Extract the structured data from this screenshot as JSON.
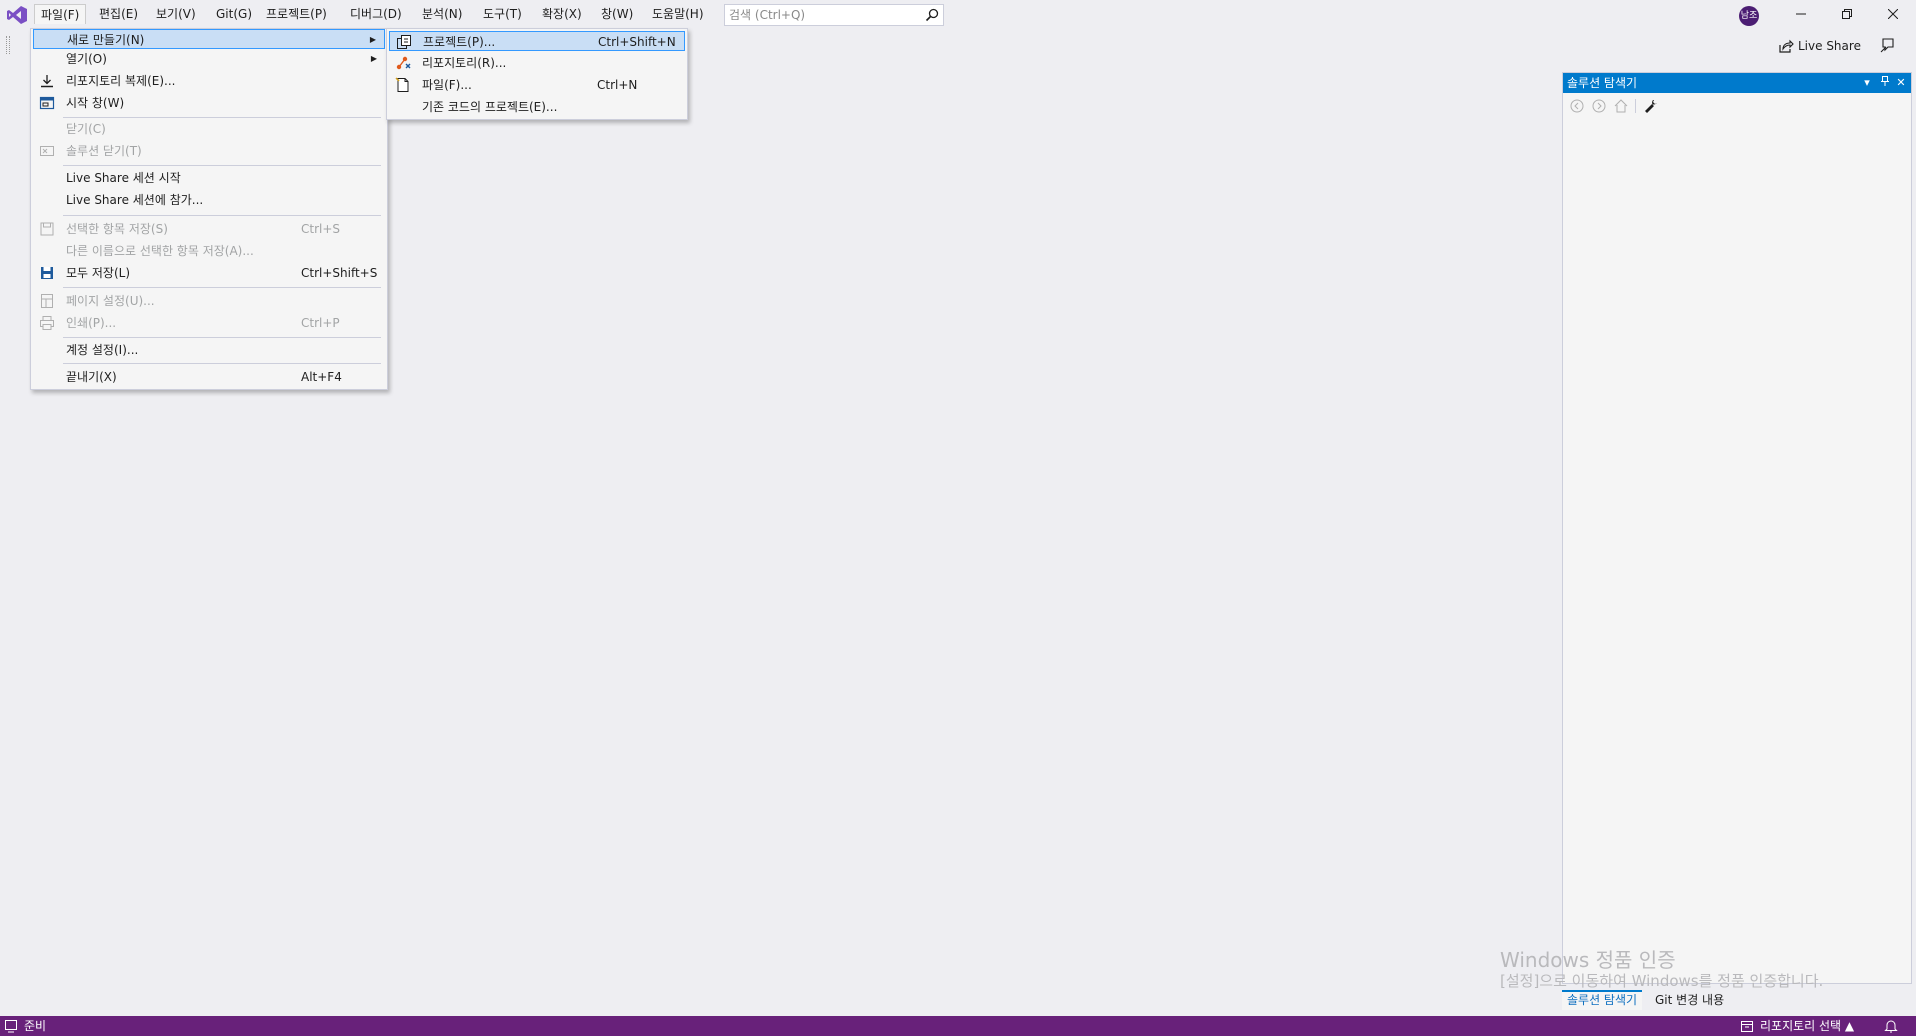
{
  "menubar": {
    "items": [
      "파일(F)",
      "편집(E)",
      "보기(V)",
      "Git(G)",
      "프로젝트(P)",
      "디버그(D)",
      "분석(N)",
      "도구(T)",
      "확장(X)",
      "창(W)",
      "도움말(H)"
    ]
  },
  "search": {
    "placeholder": "검색 (Ctrl+Q)"
  },
  "user": {
    "avatar_text": "남조"
  },
  "toolbar": {
    "live_share": "Live Share"
  },
  "file_menu": {
    "new": "새로 만들기(N)",
    "open": "열기(O)",
    "clone": "리포지토리 복제(E)...",
    "start_window": "시작 창(W)",
    "close": "닫기(C)",
    "close_solution": "솔루션 닫기(T)",
    "ls_start": "Live Share 세션 시작",
    "ls_join": "Live Share 세션에 참가...",
    "save_selected": "선택한 항목 저장(S)",
    "save_selected_sc": "Ctrl+S",
    "save_as": "다른 이름으로 선택한 항목 저장(A)...",
    "save_all": "모두 저장(L)",
    "save_all_sc": "Ctrl+Shift+S",
    "page_setup": "페이지 설정(U)...",
    "print": "인쇄(P)...",
    "print_sc": "Ctrl+P",
    "account": "계정 설정(I)...",
    "exit": "끝내기(X)",
    "exit_sc": "Alt+F4"
  },
  "new_submenu": {
    "project": "프로젝트(P)...",
    "project_sc": "Ctrl+Shift+N",
    "repository": "리포지토리(R)...",
    "file": "파일(F)...",
    "file_sc": "Ctrl+N",
    "from_existing": "기존 코드의 프로젝트(E)..."
  },
  "solution_explorer": {
    "title": "솔루션 탐색기",
    "tabs": [
      "솔루션 탐색기",
      "Git 변경 내용"
    ]
  },
  "watermark": {
    "line1": "Windows 정품 인증",
    "line2": "[설정]으로 이동하여 Windows를 정품 인증합니다."
  },
  "statusbar": {
    "status": "준비",
    "repo_select": "리포지토리 선택 ▲"
  },
  "colors": {
    "accent": "#007acc",
    "statusbar": "#68217a",
    "menu_highlight": "#c9def5",
    "disabled_text": "#a2a4a5"
  },
  "icons": {
    "logo": "visual-studio-logo-icon",
    "search": "search-icon",
    "live_share": "live-share-icon",
    "feedback": "feedback-icon"
  }
}
